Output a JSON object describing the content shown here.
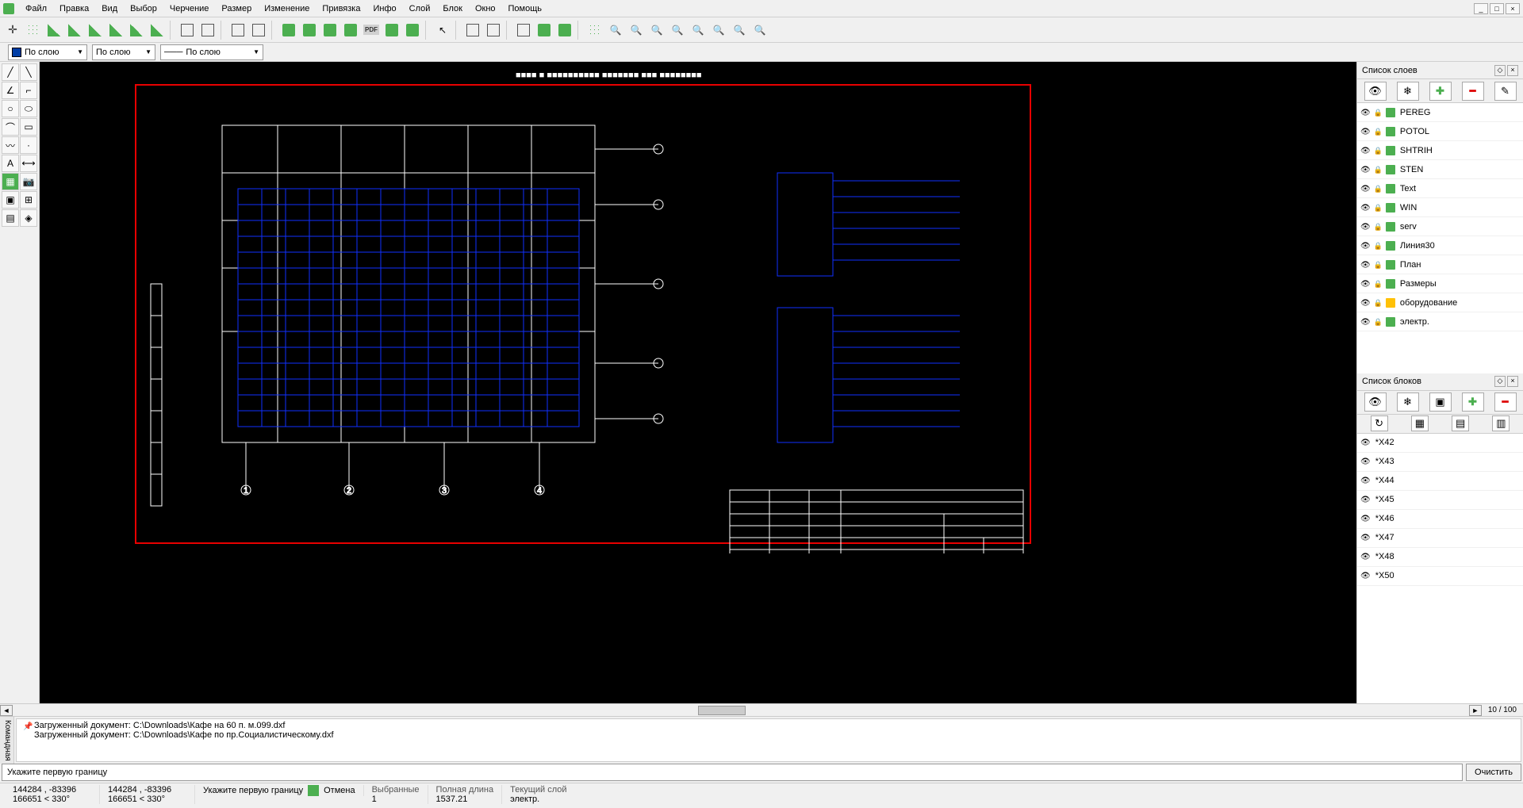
{
  "menu": [
    "Файл",
    "Правка",
    "Вид",
    "Выбор",
    "Черчение",
    "Размер",
    "Изменение",
    "Привязка",
    "Инфо",
    "Слой",
    "Блок",
    "Окно",
    "Помощь"
  ],
  "prop": {
    "by_layer": "По слою",
    "by_layer2": "По слою",
    "by_layer3": "По слою"
  },
  "panels": {
    "layers_title": "Список слоев",
    "blocks_title": "Список блоков"
  },
  "layers": [
    "PEREG",
    "POTOL",
    "SHTRIH",
    "STEN",
    "Text",
    "WIN",
    "serv",
    "Линия30",
    "План",
    "Размеры",
    "оборудование",
    "электр."
  ],
  "blocks": [
    "*X42",
    "*X43",
    "*X44",
    "*X45",
    "*X46",
    "*X47",
    "*X48",
    "*X50"
  ],
  "cmd": {
    "tab": "Командная",
    "log1": "Загруженный документ: C:\\Downloads\\Кафе  на  60  п. м.099.dxf",
    "log2": "Загруженный документ: C:\\Downloads\\Кафе по пр.Социалистическому.dxf",
    "prompt": "Укажите первую границу",
    "clear": "Очистить"
  },
  "status": {
    "coord1a": "144284 , -83396",
    "coord1b": "166651 < 330°",
    "coord2a": "144284 , -83396",
    "coord2b": "166651 < 330°",
    "hint_lbl": "Укажите первую границу",
    "cancel": "Отмена",
    "sel_lbl": "Выбранные",
    "sel_val": "1",
    "len_lbl": "Полная длина",
    "len_val": "1537.21",
    "lay_lbl": "Текущий слой",
    "lay_val": "электр."
  },
  "page": "10 / 100"
}
